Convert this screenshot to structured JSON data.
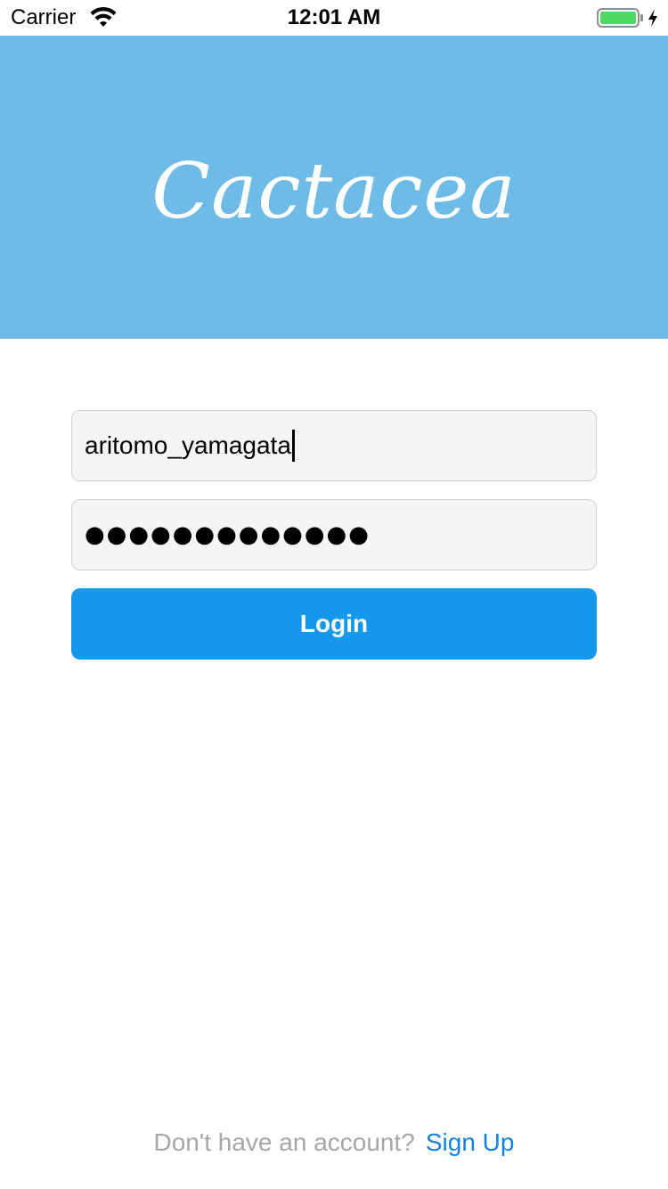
{
  "status_bar": {
    "carrier": "Carrier",
    "time": "12:01 AM",
    "wifi_icon": "wifi-icon",
    "battery_icon": "battery-charging-icon",
    "battery_color": "#4cd964"
  },
  "header": {
    "brand": "Cactacea",
    "background_color": "#6ebbe7"
  },
  "login_form": {
    "username_value": "aritomo_yamagata",
    "password_masked": "●●●●●●●●●●●●●",
    "login_label": "Login",
    "button_color": "#1398eb"
  },
  "footer": {
    "prompt": "Don't have an account?",
    "signup_label": "Sign Up",
    "link_color": "#1382e0"
  }
}
